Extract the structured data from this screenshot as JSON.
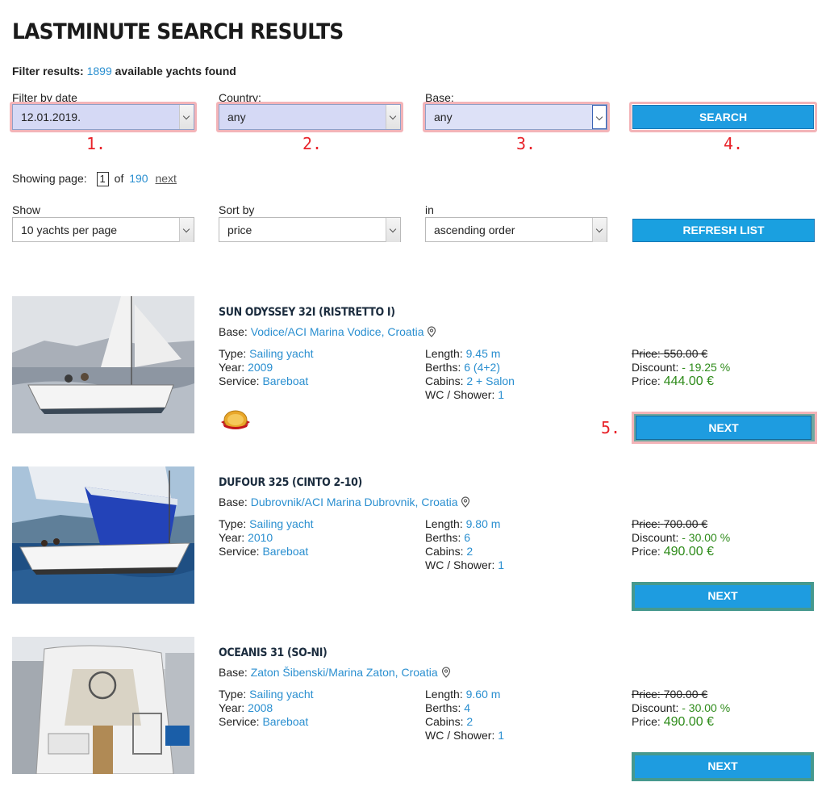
{
  "page": {
    "title": "LASTMINUTE SEARCH RESULTS",
    "filter_results_label": "Filter results:",
    "count": "1899",
    "count_suffix": "available yachts found"
  },
  "filters": {
    "date_label": "Filter by date",
    "date_value": "12.01.2019.",
    "country_label": "Country:",
    "country_value": "any",
    "base_label": "Base:",
    "base_value": "any",
    "search_label": "SEARCH"
  },
  "annotations": [
    "1.",
    "2.",
    "3.",
    "4.",
    "5."
  ],
  "pager": {
    "showing_label": "Showing page:",
    "current": "1",
    "of_label": "of",
    "total": "190",
    "next_label": "next"
  },
  "sorting": {
    "show_label": "Show",
    "show_value": "10 yachts per page",
    "sort_label": "Sort by",
    "sort_value": "price",
    "in_label": "in",
    "order_value": "ascending order",
    "refresh_label": "REFRESH LIST"
  },
  "labels": {
    "base": "Base:",
    "type": "Type:",
    "year": "Year:",
    "service": "Service:",
    "length": "Length:",
    "berths": "Berths:",
    "cabins": "Cabins:",
    "wc": "WC / Shower:",
    "price": "Price:",
    "discount": "Discount:",
    "next": "NEXT"
  },
  "yachts": [
    {
      "name": "SUN ODYSSEY 32I (RISTRETTO I)",
      "base": "Vodice/ACI Marina Vodice,",
      "country": "Croatia",
      "type": "Sailing yacht",
      "year": "2009",
      "service": "Bareboat",
      "length": "9.45 m",
      "berths": "6 (4+2)",
      "cabins": "2 + Salon",
      "wc": "1",
      "old_price": "550.00 €",
      "discount": "- 19.25 %",
      "price": "444.00 €"
    },
    {
      "name": "DUFOUR 325 (CINTO 2-10)",
      "base": "Dubrovnik/ACI Marina Dubrovnik,",
      "country": "Croatia",
      "type": "Sailing yacht",
      "year": "2010",
      "service": "Bareboat",
      "length": "9.80 m",
      "berths": "6",
      "cabins": "2",
      "wc": "1",
      "old_price": "700.00 €",
      "discount": "- 30.00 %",
      "price": "490.00 €"
    },
    {
      "name": "OCEANIS 31 (SO-NI)",
      "base": "Zaton Šibenski/Marina Zaton,",
      "country": "Croatia",
      "type": "Sailing yacht",
      "year": "2008",
      "service": "Bareboat",
      "length": "9.60 m",
      "berths": "4",
      "cabins": "2",
      "wc": "1",
      "old_price": "700.00 €",
      "discount": "- 30.00 %",
      "price": "490.00 €"
    }
  ]
}
